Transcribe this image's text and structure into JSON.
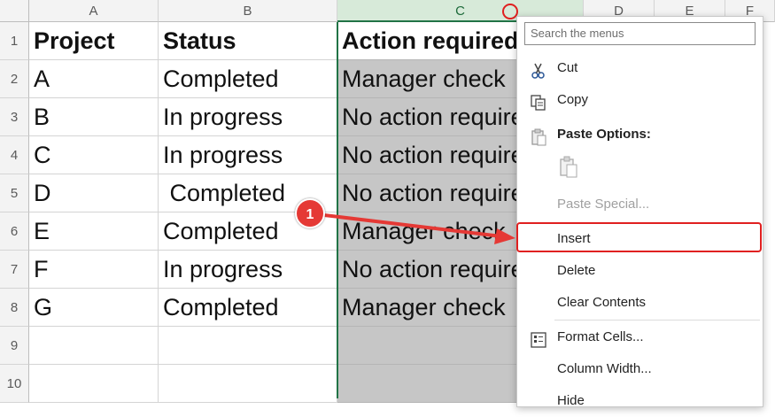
{
  "columns": [
    "A",
    "B",
    "C",
    "D",
    "E",
    "F"
  ],
  "rows": [
    "1",
    "2",
    "3",
    "4",
    "5",
    "6",
    "7",
    "8",
    "9",
    "10"
  ],
  "table": [
    [
      "Project",
      "Status",
      "Action required"
    ],
    [
      "A",
      "Completed",
      "Manager check"
    ],
    [
      "B",
      "In progress",
      "No action required"
    ],
    [
      "C",
      "In progress",
      "No action required"
    ],
    [
      "D",
      " Completed",
      "No action required"
    ],
    [
      "E",
      "Completed",
      "Manager check"
    ],
    [
      "F",
      "In progress",
      "No action required"
    ],
    [
      "G",
      "Completed",
      "Manager check"
    ]
  ],
  "menu": {
    "search_placeholder": "Search the menus",
    "cut": "Cut",
    "copy": "Copy",
    "paste_options": "Paste Options:",
    "paste_special": "Paste Special...",
    "insert": "Insert",
    "delete": "Delete",
    "clear_contents": "Clear Contents",
    "format_cells": "Format Cells...",
    "column_width": "Column Width...",
    "hide": "Hide"
  },
  "annotation": {
    "step": "1",
    "color": "#e53935"
  },
  "colors": {
    "selection_green": "#217346",
    "selected_fill": "#c6c6c6"
  }
}
